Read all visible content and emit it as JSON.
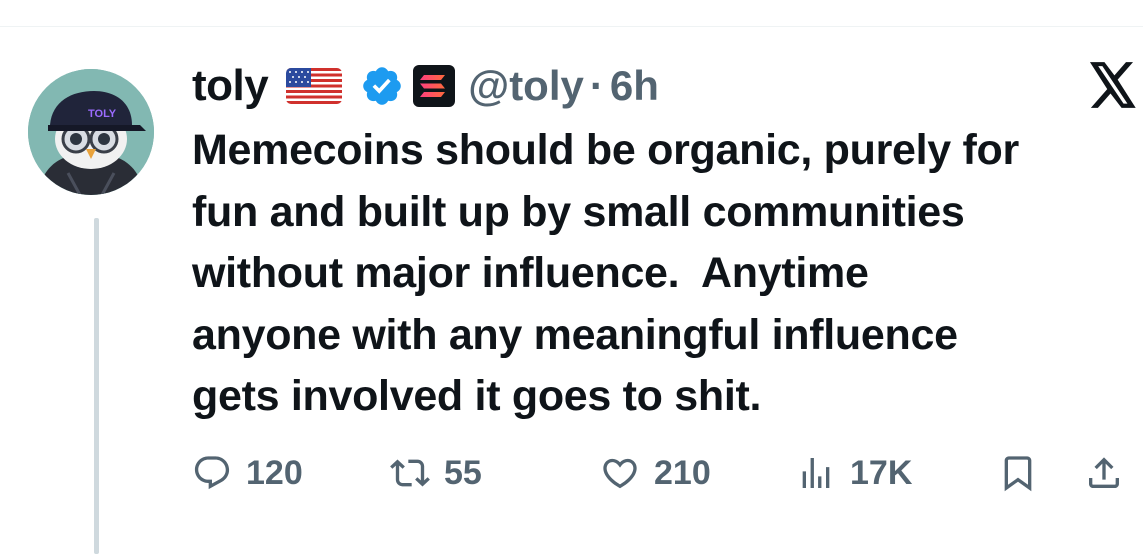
{
  "tweet": {
    "author": {
      "display_name": "toly",
      "handle": "@toly",
      "verified": true,
      "flag": "us-flag",
      "affiliate_badge": "solana-badge",
      "avatar_cap_text": "TOLY"
    },
    "dot": "·",
    "time": "6h",
    "text": "Memecoins should be organic, purely for\nfun and built up by small communities\nwithout major influence.  Anytime\nanyone with any meaningful influence\ngets involved it goes to shit.",
    "actions": {
      "replies": "120",
      "reposts": "55",
      "likes": "210",
      "views": "17K"
    }
  },
  "colors": {
    "text": "#0f1419",
    "secondary": "#536471",
    "verified_blue": "#1d9bf0",
    "thread_line": "#cfd9de"
  },
  "icons": [
    "reply-icon",
    "repost-icon",
    "like-icon",
    "views-icon",
    "bookmark-icon",
    "share-icon",
    "x-logo-icon"
  ]
}
